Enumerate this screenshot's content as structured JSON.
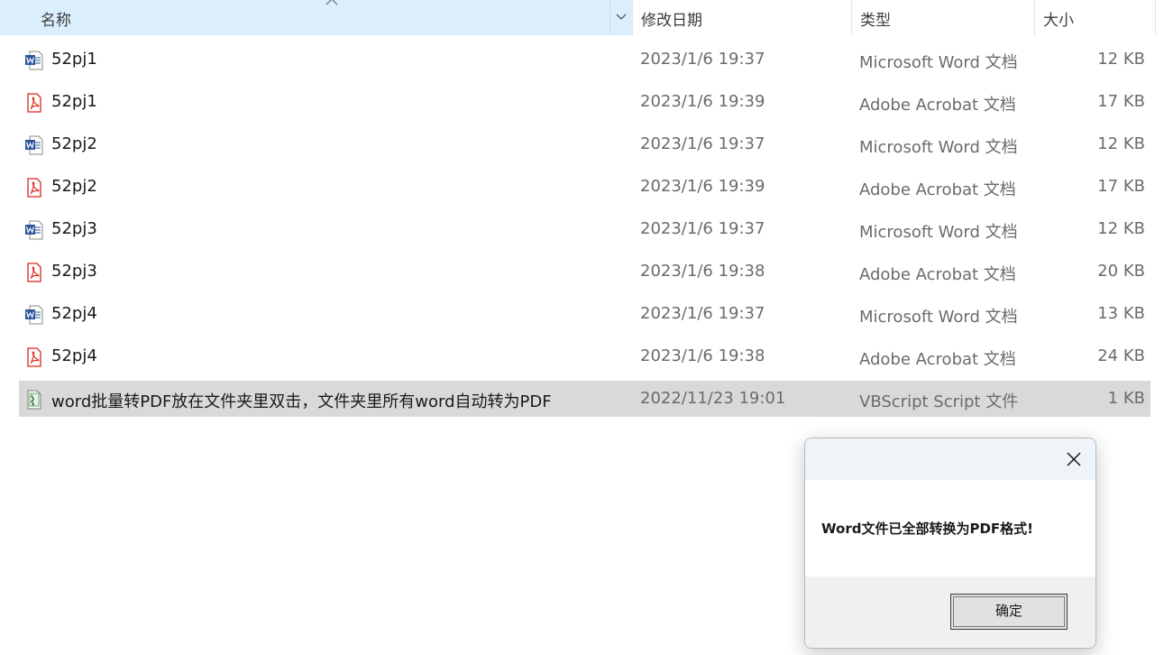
{
  "columns": {
    "name": "名称",
    "date": "修改日期",
    "type": "类型",
    "size": "大小"
  },
  "files": [
    {
      "name": "52pj1",
      "date": "2023/1/6 19:37",
      "type": "Microsoft Word 文档",
      "size": "12 KB",
      "icon": "word-doc-icon"
    },
    {
      "name": "52pj1",
      "date": "2023/1/6 19:39",
      "type": "Adobe Acrobat 文档",
      "size": "17 KB",
      "icon": "pdf-icon"
    },
    {
      "name": "52pj2",
      "date": "2023/1/6 19:37",
      "type": "Microsoft Word 文档",
      "size": "12 KB",
      "icon": "word-doc-icon"
    },
    {
      "name": "52pj2",
      "date": "2023/1/6 19:39",
      "type": "Adobe Acrobat 文档",
      "size": "17 KB",
      "icon": "pdf-icon"
    },
    {
      "name": "52pj3",
      "date": "2023/1/6 19:37",
      "type": "Microsoft Word 文档",
      "size": "12 KB",
      "icon": "word-doc-icon"
    },
    {
      "name": "52pj3",
      "date": "2023/1/6 19:38",
      "type": "Adobe Acrobat 文档",
      "size": "20 KB",
      "icon": "pdf-icon"
    },
    {
      "name": "52pj4",
      "date": "2023/1/6 19:37",
      "type": "Microsoft Word 文档",
      "size": "13 KB",
      "icon": "word-doc-icon"
    },
    {
      "name": "52pj4",
      "date": "2023/1/6 19:38",
      "type": "Adobe Acrobat 文档",
      "size": "24 KB",
      "icon": "pdf-icon"
    },
    {
      "name": "word批量转PDF放在文件夹里双击，文件夹里所有word自动转为PDF",
      "date": "2022/11/23 19:01",
      "type": "VBScript Script 文件",
      "size": "1 KB",
      "icon": "vbscript-icon",
      "selected": true
    }
  ],
  "dialog": {
    "message": "Word文件已全部转换为PDF格式!",
    "ok_label": "确定"
  },
  "colors": {
    "header_selected": "#dbeefc",
    "row_selected": "#d9d9d9",
    "word_blue": "#2b579a",
    "pdf_red": "#d9261c"
  }
}
